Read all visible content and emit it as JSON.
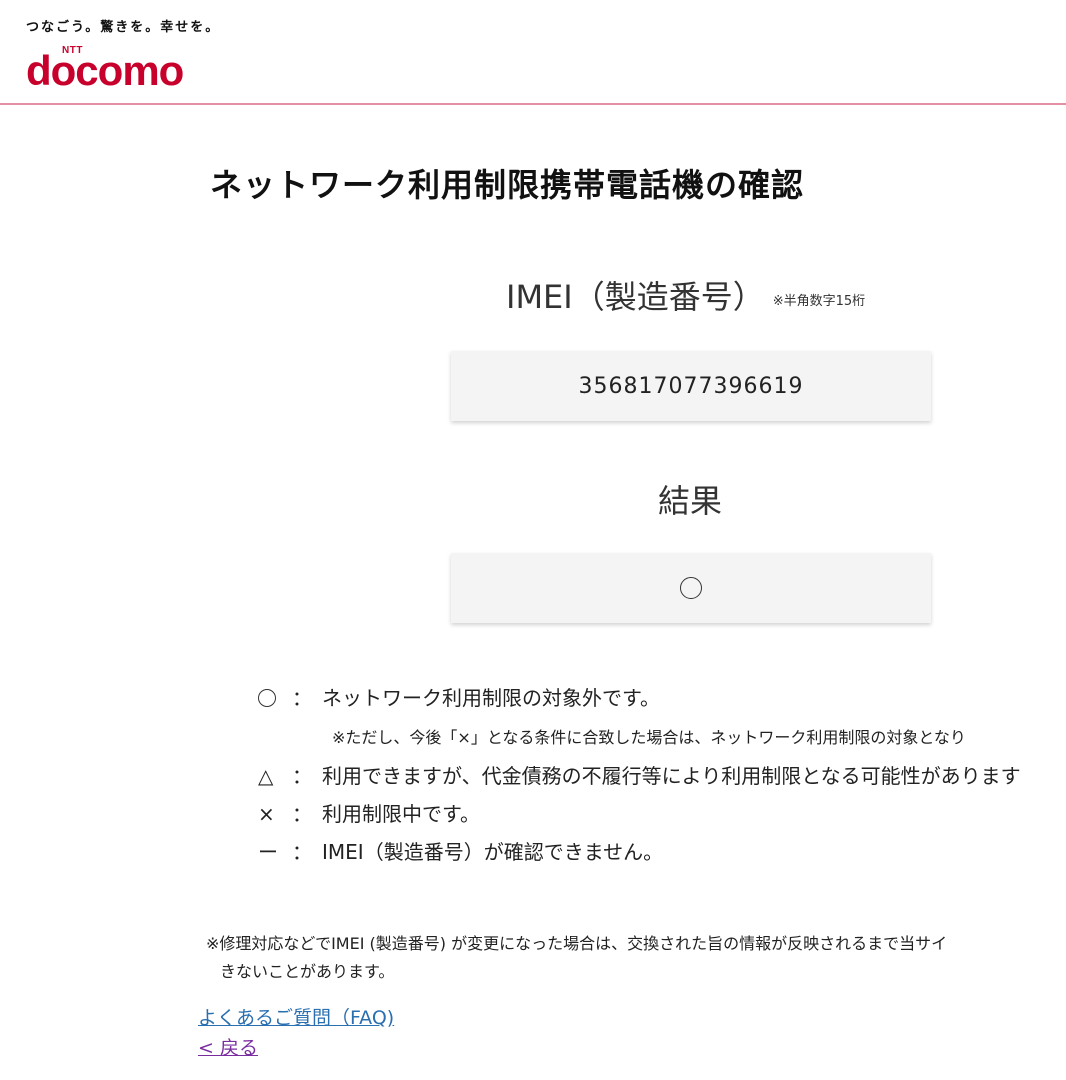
{
  "header": {
    "tagline": "つなごう。驚きを。幸せを。",
    "logo_small": "NTT",
    "logo_text": "docomo",
    "brand_color": "#c8002c"
  },
  "title": "ネットワーク利用制限携帯電話機の確認",
  "imei": {
    "label": "IMEI（製造番号）",
    "note": "※半角数字15桁",
    "value": "356817077396619"
  },
  "result": {
    "label": "結果",
    "value_icon": "circle-icon"
  },
  "legend": {
    "circle": {
      "symbol_icon": "circle-icon",
      "colon": "：",
      "text": "ネットワーク利用制限の対象外です。"
    },
    "circle_note": "※ただし、今後「×」となる条件に合致した場合は、ネットワーク利用制限の対象となり",
    "triangle": {
      "symbol": "△",
      "colon": "：",
      "text": "利用できますが、代金債務の不履行等により利用制限となる可能性があります"
    },
    "cross": {
      "symbol": "×",
      "colon": "：",
      "text": "利用制限中です。"
    },
    "dash": {
      "symbol": "ー",
      "colon": "：",
      "text": "IMEI（製造番号）が確認できません。"
    }
  },
  "footnote": {
    "line1": "※修理対応などでIMEI (製造番号) が変更になった場合は、交換された旨の情報が反映されるまで当サイ",
    "line2": "きないことがあります。"
  },
  "links": {
    "faq": "よくあるご質問（FAQ)",
    "back": "< 戻る"
  }
}
